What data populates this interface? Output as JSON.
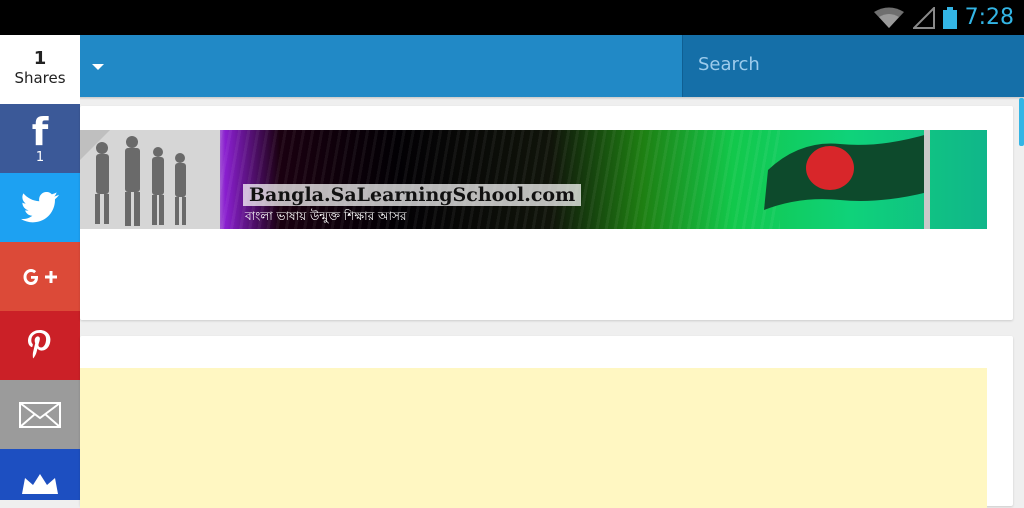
{
  "status": {
    "time": "7:28"
  },
  "search": {
    "placeholder": "Search"
  },
  "share": {
    "count": "1",
    "label": "Shares",
    "facebook_count": "1"
  },
  "banner": {
    "title": "Bangla.SaLearningSchool.com",
    "subtitle": "বাংলা ভাষায় উন্মুক্ত শিক্ষার আসর"
  },
  "colors": {
    "topbar": "#2189c6",
    "facebook": "#3b5998",
    "twitter": "#1da1f2",
    "googleplus": "#dc4a38",
    "pinterest": "#cb2027",
    "email": "#9b9b9b",
    "crown": "#1d4fc1",
    "ad_background": "#fff7c2"
  },
  "icons": [
    "wifi-icon",
    "signal-icon",
    "battery-icon",
    "dropdown-caret-icon",
    "facebook-icon",
    "twitter-icon",
    "google-plus-icon",
    "pinterest-icon",
    "email-icon",
    "crown-icon"
  ]
}
